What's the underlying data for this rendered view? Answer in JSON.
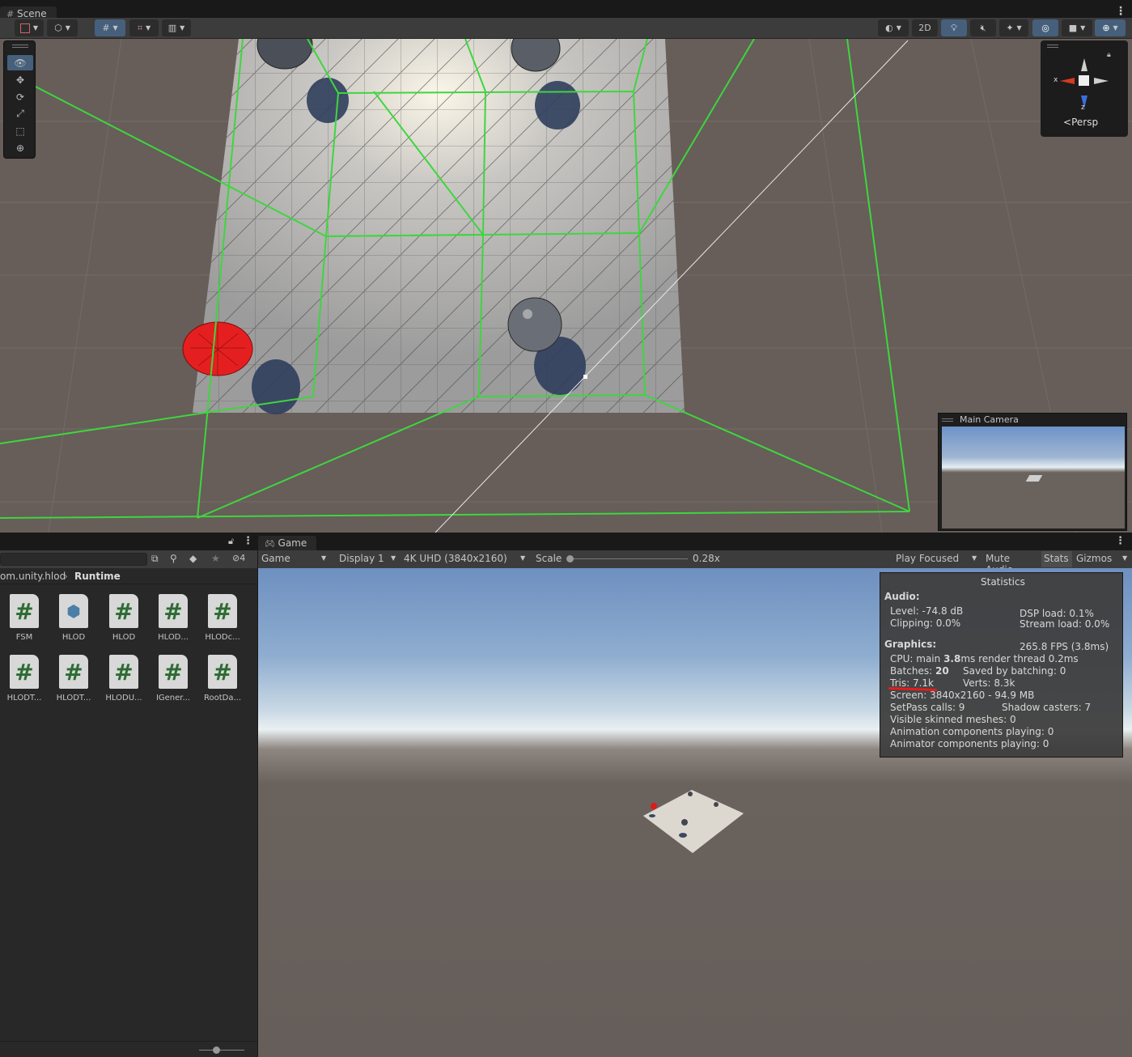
{
  "scene_tab": {
    "label": "Scene"
  },
  "scene_toolbar": {
    "btn_2d": "2D"
  },
  "gizmo": {
    "x_label": "x",
    "z_label": "z",
    "persp_label": "Persp"
  },
  "camera_preview": {
    "title": "Main Camera"
  },
  "project": {
    "hidden_count": "4",
    "breadcrumb_parent": "om.unity.hlod",
    "breadcrumb_current": "Runtime",
    "assets": [
      {
        "label": "FSM",
        "icon": "script-icon"
      },
      {
        "label": "HLOD",
        "icon": "package-icon"
      },
      {
        "label": "HLOD",
        "icon": "script-icon"
      },
      {
        "label": "HLOD...",
        "icon": "script-icon"
      },
      {
        "label": "HLODc...",
        "icon": "script-icon"
      },
      {
        "label": "HLODT...",
        "icon": "script-icon"
      },
      {
        "label": "HLODT...",
        "icon": "script-icon"
      },
      {
        "label": "HLODU...",
        "icon": "script-icon"
      },
      {
        "label": "IGener...",
        "icon": "script-icon"
      },
      {
        "label": "RootDa...",
        "icon": "script-icon"
      }
    ]
  },
  "game_tab": {
    "label": "Game"
  },
  "game_toolbar": {
    "view": "Game",
    "display": "Display 1",
    "resolution": "4K UHD (3840x2160)",
    "scale_label": "Scale",
    "scale_value": "0.28x",
    "scale_fraction": 0.0,
    "play_mode": "Play Focused",
    "mute_audio": "Mute Audio",
    "stats": "Stats",
    "gizmos": "Gizmos"
  },
  "statistics": {
    "title": "Statistics",
    "audio_header": "Audio:",
    "level": "Level: -74.8 dB",
    "dsp_load": "DSP load: 0.1%",
    "clipping": "Clipping: 0.0%",
    "stream_load": "Stream load: 0.0%",
    "graphics_header": "Graphics:",
    "fps": "265.8 FPS (3.8ms)",
    "cpu_prefix": "CPU: main ",
    "cpu_main": "3.8",
    "cpu_suffix": "ms  render thread 0.2ms",
    "batches_prefix": "Batches: ",
    "batches": "20",
    "saved_by_batching": "Saved by batching: 0",
    "tris": "Tris: 7.1k",
    "verts": "Verts: 8.3k",
    "screen": "Screen: 3840x2160 - 94.9 MB",
    "setpass": "SetPass calls: 9",
    "shadow_casters": "Shadow casters: 7",
    "skinned": "Visible skinned meshes: 0",
    "anim_components": "Animation components playing: 0",
    "animator_components": "Animator components playing: 0"
  },
  "colors": {
    "accent": "#46607c",
    "frustum": "#3ed63e",
    "selection_red": "#e81c1c"
  }
}
